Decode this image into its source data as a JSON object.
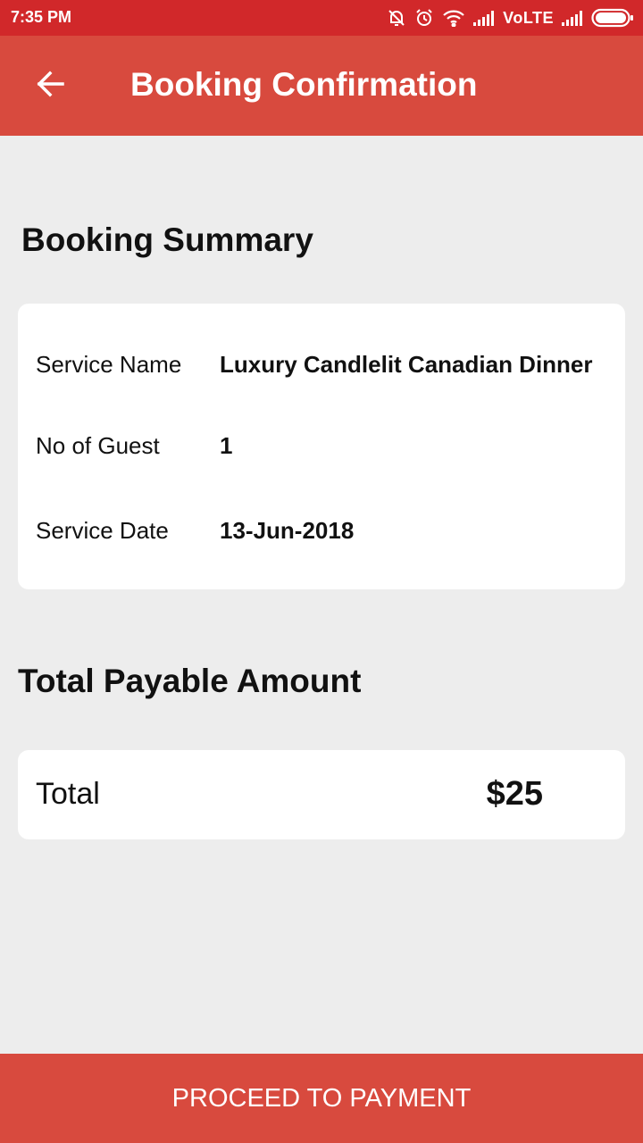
{
  "status_bar": {
    "time": "7:35 PM",
    "network_label": "VoLTE",
    "icons": [
      "silent-bell-icon",
      "alarm-icon",
      "wifi-icon",
      "signal-icon",
      "signal-icon",
      "battery-icon"
    ]
  },
  "app_bar": {
    "title": "Booking Confirmation",
    "back_icon": "arrow-left-icon",
    "color": "#d84a3e"
  },
  "booking_summary": {
    "heading": "Booking Summary",
    "rows": [
      {
        "label": "Service Name",
        "value": "Luxury Candlelit Canadian Dinner"
      },
      {
        "label": "No of Guest",
        "value": "1"
      },
      {
        "label": "Service Date",
        "value": "13-Jun-2018"
      }
    ]
  },
  "total_payable": {
    "heading": "Total Payable Amount",
    "label": "Total",
    "amount": "$25"
  },
  "footer": {
    "button_label": "PROCEED TO PAYMENT",
    "color": "#d84a3e"
  },
  "colors": {
    "status_bar": "#d1282a",
    "accent": "#d84a3e",
    "background": "#ededed"
  }
}
